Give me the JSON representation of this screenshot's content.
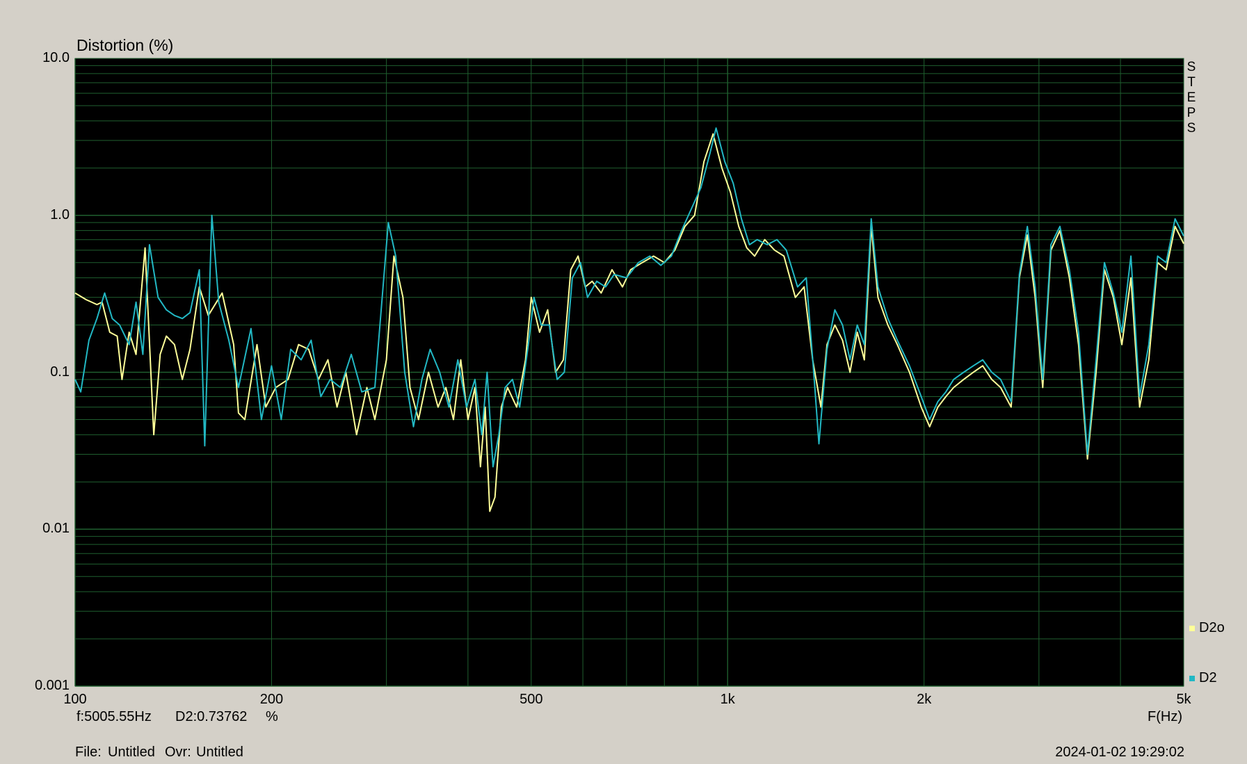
{
  "chart_data": {
    "type": "line",
    "ylabel": "Distortion (%)",
    "xlabel": "F(Hz)",
    "x_scale": "log",
    "y_scale": "log",
    "xlim": [
      100,
      5000
    ],
    "ylim": [
      0.001,
      10
    ],
    "x_ticks": [
      {
        "value": 100,
        "label": "100"
      },
      {
        "value": 200,
        "label": "200"
      },
      {
        "value": 500,
        "label": "500"
      },
      {
        "value": 1000,
        "label": "1k"
      },
      {
        "value": 2000,
        "label": "2k"
      },
      {
        "value": 5000,
        "label": "5k"
      }
    ],
    "y_ticks": [
      {
        "value": 10,
        "label": "10.0"
      },
      {
        "value": 1,
        "label": "1.0"
      },
      {
        "value": 0.1,
        "label": "0.1"
      },
      {
        "value": 0.01,
        "label": "0.01"
      },
      {
        "value": 0.001,
        "label": "0.001"
      }
    ],
    "grid": true,
    "background": "#000000",
    "grid_color": "#1f5f2f",
    "legend_position": "right",
    "series": [
      {
        "name": "D2o",
        "color": "#ffff99",
        "points": [
          [
            100,
            0.32
          ],
          [
            104,
            0.29
          ],
          [
            108,
            0.27
          ],
          [
            110,
            0.28
          ],
          [
            113,
            0.18
          ],
          [
            116,
            0.17
          ],
          [
            118,
            0.09
          ],
          [
            121,
            0.18
          ],
          [
            124,
            0.13
          ],
          [
            128,
            0.62
          ],
          [
            132,
            0.04
          ],
          [
            135,
            0.13
          ],
          [
            138,
            0.17
          ],
          [
            142,
            0.15
          ],
          [
            146,
            0.09
          ],
          [
            150,
            0.14
          ],
          [
            155,
            0.35
          ],
          [
            160,
            0.23
          ],
          [
            168,
            0.32
          ],
          [
            175,
            0.15
          ],
          [
            178,
            0.055
          ],
          [
            182,
            0.05
          ],
          [
            190,
            0.15
          ],
          [
            196,
            0.06
          ],
          [
            203,
            0.08
          ],
          [
            212,
            0.09
          ],
          [
            220,
            0.15
          ],
          [
            228,
            0.14
          ],
          [
            236,
            0.09
          ],
          [
            244,
            0.12
          ],
          [
            252,
            0.06
          ],
          [
            260,
            0.1
          ],
          [
            270,
            0.04
          ],
          [
            280,
            0.08
          ],
          [
            288,
            0.05
          ],
          [
            300,
            0.12
          ],
          [
            308,
            0.55
          ],
          [
            318,
            0.3
          ],
          [
            326,
            0.08
          ],
          [
            336,
            0.05
          ],
          [
            348,
            0.1
          ],
          [
            360,
            0.06
          ],
          [
            370,
            0.08
          ],
          [
            380,
            0.05
          ],
          [
            390,
            0.12
          ],
          [
            400,
            0.05
          ],
          [
            410,
            0.08
          ],
          [
            418,
            0.025
          ],
          [
            425,
            0.06
          ],
          [
            432,
            0.013
          ],
          [
            440,
            0.016
          ],
          [
            450,
            0.06
          ],
          [
            460,
            0.08
          ],
          [
            475,
            0.06
          ],
          [
            490,
            0.12
          ],
          [
            500,
            0.3
          ],
          [
            515,
            0.18
          ],
          [
            530,
            0.25
          ],
          [
            545,
            0.1
          ],
          [
            560,
            0.12
          ],
          [
            575,
            0.45
          ],
          [
            590,
            0.55
          ],
          [
            605,
            0.35
          ],
          [
            620,
            0.38
          ],
          [
            640,
            0.32
          ],
          [
            665,
            0.45
          ],
          [
            690,
            0.35
          ],
          [
            710,
            0.45
          ],
          [
            740,
            0.5
          ],
          [
            770,
            0.55
          ],
          [
            800,
            0.5
          ],
          [
            830,
            0.6
          ],
          [
            860,
            0.85
          ],
          [
            890,
            1.0
          ],
          [
            920,
            2.2
          ],
          [
            950,
            3.3
          ],
          [
            980,
            2.0
          ],
          [
            1010,
            1.4
          ],
          [
            1040,
            0.85
          ],
          [
            1070,
            0.62
          ],
          [
            1100,
            0.55
          ],
          [
            1140,
            0.7
          ],
          [
            1180,
            0.6
          ],
          [
            1220,
            0.55
          ],
          [
            1270,
            0.3
          ],
          [
            1310,
            0.35
          ],
          [
            1350,
            0.12
          ],
          [
            1390,
            0.06
          ],
          [
            1420,
            0.15
          ],
          [
            1460,
            0.2
          ],
          [
            1500,
            0.16
          ],
          [
            1540,
            0.1
          ],
          [
            1580,
            0.18
          ],
          [
            1620,
            0.12
          ],
          [
            1660,
            0.85
          ],
          [
            1700,
            0.3
          ],
          [
            1760,
            0.2
          ],
          [
            1820,
            0.15
          ],
          [
            1900,
            0.1
          ],
          [
            1980,
            0.06
          ],
          [
            2040,
            0.045
          ],
          [
            2100,
            0.06
          ],
          [
            2160,
            0.07
          ],
          [
            2220,
            0.08
          ],
          [
            2300,
            0.09
          ],
          [
            2380,
            0.1
          ],
          [
            2460,
            0.11
          ],
          [
            2540,
            0.09
          ],
          [
            2620,
            0.08
          ],
          [
            2720,
            0.06
          ],
          [
            2800,
            0.4
          ],
          [
            2880,
            0.75
          ],
          [
            2960,
            0.3
          ],
          [
            3040,
            0.08
          ],
          [
            3130,
            0.6
          ],
          [
            3230,
            0.8
          ],
          [
            3340,
            0.4
          ],
          [
            3450,
            0.15
          ],
          [
            3560,
            0.028
          ],
          [
            3670,
            0.1
          ],
          [
            3780,
            0.45
          ],
          [
            3900,
            0.3
          ],
          [
            4020,
            0.15
          ],
          [
            4150,
            0.4
          ],
          [
            4280,
            0.06
          ],
          [
            4420,
            0.12
          ],
          [
            4560,
            0.5
          ],
          [
            4700,
            0.45
          ],
          [
            4850,
            0.85
          ],
          [
            5000,
            0.66
          ]
        ]
      },
      {
        "name": "D2",
        "color": "#22b8c4",
        "points": [
          [
            100,
            0.09
          ],
          [
            102,
            0.075
          ],
          [
            105,
            0.16
          ],
          [
            108,
            0.22
          ],
          [
            111,
            0.32
          ],
          [
            114,
            0.22
          ],
          [
            117,
            0.2
          ],
          [
            121,
            0.15
          ],
          [
            124,
            0.28
          ],
          [
            127,
            0.13
          ],
          [
            130,
            0.65
          ],
          [
            134,
            0.3
          ],
          [
            138,
            0.25
          ],
          [
            142,
            0.23
          ],
          [
            146,
            0.22
          ],
          [
            150,
            0.24
          ],
          [
            155,
            0.45
          ],
          [
            158,
            0.034
          ],
          [
            162,
            1.0
          ],
          [
            166,
            0.28
          ],
          [
            172,
            0.16
          ],
          [
            178,
            0.08
          ],
          [
            186,
            0.19
          ],
          [
            193,
            0.05
          ],
          [
            200,
            0.11
          ],
          [
            207,
            0.05
          ],
          [
            214,
            0.14
          ],
          [
            222,
            0.12
          ],
          [
            230,
            0.16
          ],
          [
            238,
            0.07
          ],
          [
            246,
            0.09
          ],
          [
            255,
            0.08
          ],
          [
            265,
            0.13
          ],
          [
            275,
            0.075
          ],
          [
            288,
            0.08
          ],
          [
            302,
            0.9
          ],
          [
            310,
            0.55
          ],
          [
            320,
            0.1
          ],
          [
            330,
            0.045
          ],
          [
            340,
            0.09
          ],
          [
            350,
            0.14
          ],
          [
            362,
            0.1
          ],
          [
            374,
            0.06
          ],
          [
            386,
            0.12
          ],
          [
            398,
            0.06
          ],
          [
            410,
            0.09
          ],
          [
            420,
            0.04
          ],
          [
            428,
            0.1
          ],
          [
            437,
            0.025
          ],
          [
            446,
            0.04
          ],
          [
            456,
            0.08
          ],
          [
            468,
            0.09
          ],
          [
            480,
            0.06
          ],
          [
            495,
            0.15
          ],
          [
            505,
            0.3
          ],
          [
            518,
            0.2
          ],
          [
            533,
            0.2
          ],
          [
            548,
            0.09
          ],
          [
            562,
            0.1
          ],
          [
            578,
            0.4
          ],
          [
            595,
            0.5
          ],
          [
            610,
            0.3
          ],
          [
            630,
            0.38
          ],
          [
            650,
            0.35
          ],
          [
            670,
            0.42
          ],
          [
            700,
            0.4
          ],
          [
            730,
            0.5
          ],
          [
            760,
            0.55
          ],
          [
            790,
            0.48
          ],
          [
            820,
            0.55
          ],
          [
            850,
            0.8
          ],
          [
            880,
            1.1
          ],
          [
            910,
            1.5
          ],
          [
            940,
            2.5
          ],
          [
            960,
            3.6
          ],
          [
            990,
            2.2
          ],
          [
            1020,
            1.6
          ],
          [
            1050,
            0.95
          ],
          [
            1080,
            0.65
          ],
          [
            1110,
            0.7
          ],
          [
            1150,
            0.65
          ],
          [
            1190,
            0.7
          ],
          [
            1230,
            0.6
          ],
          [
            1280,
            0.35
          ],
          [
            1320,
            0.4
          ],
          [
            1355,
            0.1
          ],
          [
            1380,
            0.035
          ],
          [
            1420,
            0.14
          ],
          [
            1460,
            0.25
          ],
          [
            1500,
            0.2
          ],
          [
            1540,
            0.12
          ],
          [
            1580,
            0.2
          ],
          [
            1620,
            0.15
          ],
          [
            1660,
            0.95
          ],
          [
            1700,
            0.35
          ],
          [
            1760,
            0.22
          ],
          [
            1820,
            0.16
          ],
          [
            1900,
            0.11
          ],
          [
            1980,
            0.07
          ],
          [
            2040,
            0.05
          ],
          [
            2100,
            0.065
          ],
          [
            2160,
            0.075
          ],
          [
            2220,
            0.09
          ],
          [
            2300,
            0.1
          ],
          [
            2380,
            0.11
          ],
          [
            2460,
            0.12
          ],
          [
            2540,
            0.1
          ],
          [
            2620,
            0.09
          ],
          [
            2720,
            0.065
          ],
          [
            2800,
            0.42
          ],
          [
            2880,
            0.85
          ],
          [
            2960,
            0.35
          ],
          [
            3040,
            0.09
          ],
          [
            3130,
            0.65
          ],
          [
            3230,
            0.85
          ],
          [
            3340,
            0.45
          ],
          [
            3450,
            0.18
          ],
          [
            3560,
            0.03
          ],
          [
            3670,
            0.12
          ],
          [
            3780,
            0.5
          ],
          [
            3900,
            0.32
          ],
          [
            4020,
            0.18
          ],
          [
            4150,
            0.55
          ],
          [
            4280,
            0.07
          ],
          [
            4420,
            0.15
          ],
          [
            4560,
            0.55
          ],
          [
            4700,
            0.5
          ],
          [
            4850,
            0.95
          ],
          [
            5000,
            0.73762
          ]
        ]
      }
    ]
  },
  "legend": [
    {
      "label": "D2o",
      "color": "#ffff99"
    },
    {
      "label": "D2",
      "color": "#22b8c4"
    }
  ],
  "steps_label": [
    "S",
    "T",
    "E",
    "P",
    "S"
  ],
  "readout": {
    "frequency": "f:5005.55Hz",
    "distortion": "D2:0.73762",
    "unit": "%"
  },
  "footer": {
    "file_label": "File:",
    "file_name": "Untitled",
    "ovr_label": "Ovr:",
    "ovr_name": "Untitled",
    "timestamp": "2024-01-02 19:29:02"
  }
}
